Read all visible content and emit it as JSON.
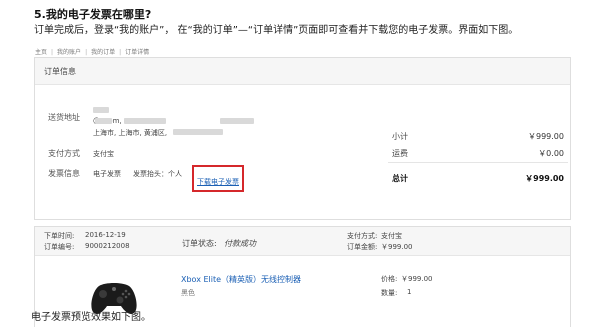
{
  "article": {
    "heading": "5.我的电子发票在哪里?",
    "description": "订单完成后，登录“我的账户”， 在“我的订单”—“订单详情”页面即可查看并下载您的电子发票。界面如下图。",
    "footer": "电子发票预览效果如下图。"
  },
  "breadcrumb": [
    "主页",
    "我的账户",
    "我的订单",
    "订单详情"
  ],
  "order_info": {
    "title": "订单信息",
    "address_label": "送货地址",
    "address_line1": "@           .com, 13912",
    "address_line2": "上海市, 上海市, 黄浦区,",
    "payment_label": "支付方式",
    "payment_value": "支付宝",
    "invoice_label": "发票信息",
    "invoice_type": "电子发票",
    "invoice_title": "发票抬头：个人",
    "invoice_download": "下载电子发票"
  },
  "summary": {
    "subtotal_label": "小计",
    "subtotal_value": "￥999.00",
    "shipping_label": "运费",
    "shipping_value": "￥0.00",
    "total_label": "总计",
    "total_value": "￥999.00"
  },
  "order_detail": {
    "date_label": "下单时间:",
    "date_value": "2016-12-19",
    "number_label": "订单编号:",
    "number_value": "9000212008",
    "status_label": "订单状态:",
    "status_value": "付款成功",
    "pay_label": "支付方式:",
    "pay_value": "支付宝",
    "amount_label": "订单金额:",
    "amount_value": "￥999.00"
  },
  "product": {
    "name": "Xbox Elite（精英版）无线控制器",
    "color": "黑色",
    "price_label": "价格:",
    "price_value": "￥999.00",
    "qty_label": "数量:",
    "qty_value": "1",
    "image_icon": "game-controller-icon"
  },
  "colors": {
    "link": "#1a5fb4",
    "highlight_border": "#d5282b",
    "header_bg": "#f6f6f6",
    "border": "#dedede"
  }
}
